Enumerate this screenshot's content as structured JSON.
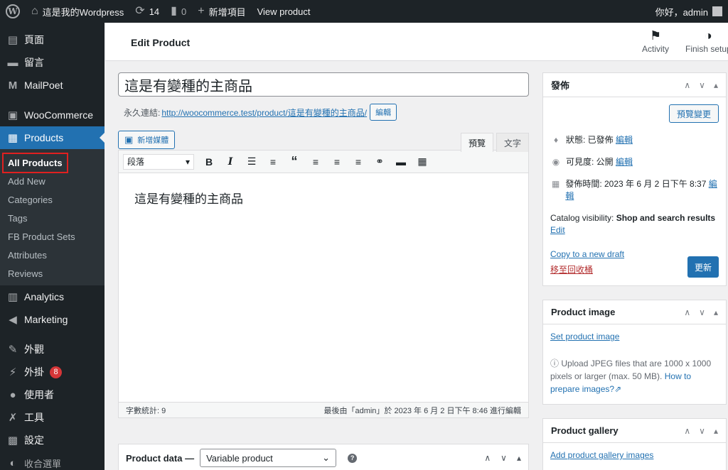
{
  "admin_bar": {
    "site_name": "這是我的Wordpress",
    "updates_count": "14",
    "comments_count": "0",
    "new_label": "新增項目",
    "view_product": "View product",
    "greeting": "你好，admin"
  },
  "sidebar": {
    "items": [
      {
        "label": "頁面",
        "icon": "pages-icon"
      },
      {
        "label": "留言",
        "icon": "comments-icon"
      },
      {
        "label": "MailPoet",
        "icon": "mailpoet-icon"
      },
      {
        "label": "WooCommerce",
        "icon": "woocommerce-icon"
      },
      {
        "label": "Products",
        "icon": "products-icon"
      },
      {
        "label": "Analytics",
        "icon": "analytics-icon"
      },
      {
        "label": "Marketing",
        "icon": "marketing-icon"
      },
      {
        "label": "外觀",
        "icon": "appearance-icon"
      },
      {
        "label": "外掛",
        "icon": "plugins-icon",
        "badge": "8"
      },
      {
        "label": "使用者",
        "icon": "users-icon"
      },
      {
        "label": "工具",
        "icon": "tools-icon"
      },
      {
        "label": "設定",
        "icon": "settings-icon"
      },
      {
        "label": "收合選單",
        "icon": "collapse-icon"
      }
    ],
    "submenu": [
      "All Products",
      "Add New",
      "Categories",
      "Tags",
      "FB Product Sets",
      "Attributes",
      "Reviews"
    ]
  },
  "header": {
    "title": "Edit Product",
    "activity": "Activity",
    "finish_setup": "Finish setup"
  },
  "editor": {
    "post_title": "這是有變種的主商品",
    "permalink_label": "永久連結:",
    "permalink_url": "http://woocommerce.test/product/這是有變種的主商品/",
    "edit_btn": "編輯",
    "add_media": "新增媒體",
    "tab_visual": "預覽",
    "tab_text": "文字",
    "format_select": "段落",
    "content": "這是有變種的主商品",
    "word_count": "字數統計: 9",
    "last_edited": "最後由「admin」於 2023 年 6 月 2 日下午 8:46 進行編輯"
  },
  "product_data": {
    "title": "Product data —",
    "type": "Variable product"
  },
  "publish": {
    "title": "發佈",
    "preview_changes": "預覽變更",
    "status_label": "狀態: 已發佈",
    "visibility_label": "可見度: 公開",
    "published_label": "發佈時間: 2023 年 6 月 2 日下午 8:37",
    "edit": "編輯",
    "catalog_visibility_label": "Catalog visibility:",
    "catalog_visibility_value": "Shop and search results",
    "catalog_edit": "Edit",
    "copy_draft": "Copy to a new draft",
    "trash": "移至回收桶",
    "update": "更新"
  },
  "product_image": {
    "title": "Product image",
    "set_image": "Set product image",
    "info": "Upload JPEG files that are 1000 x 1000 pixels or larger (max. 50 MB).",
    "how_to": "How to prepare images?"
  },
  "product_gallery": {
    "title": "Product gallery",
    "add_images": "Add product gallery images"
  }
}
